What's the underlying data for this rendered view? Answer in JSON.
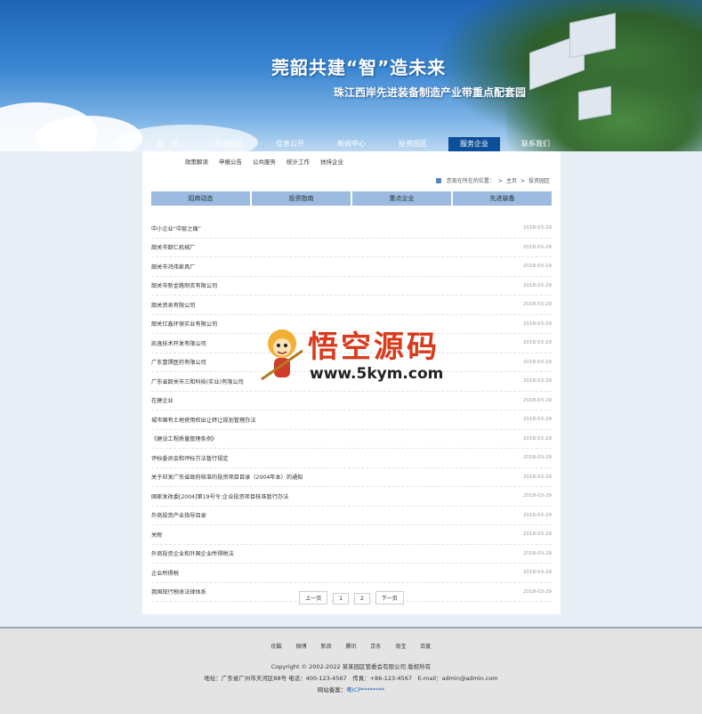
{
  "header": {
    "slogan": "莞韶共建“智”造未来",
    "subslogan": "珠江西岸先进装备制造产业带重点配套园",
    "nav": [
      {
        "label": "首　页"
      },
      {
        "label": "走进园区"
      },
      {
        "label": "信息公开"
      },
      {
        "label": "新闻中心"
      },
      {
        "label": "投资园区"
      },
      {
        "label": "服务企业",
        "active": true
      },
      {
        "label": "联系我们"
      }
    ]
  },
  "subnav": [
    "政策解读",
    "申报公告",
    "公共服务",
    "统计工作",
    "扶持企业"
  ],
  "breadcrumb": {
    "prefix": "您现在所在的位置：",
    "sep": ">",
    "home": "主页",
    "current": "投资园区"
  },
  "tabs": [
    "招商动态",
    "投资指南",
    "重点企业",
    "先进装备"
  ],
  "list": [
    {
      "title": "中小企业“中层之痛”",
      "date": "2018-03-29"
    },
    {
      "title": "韶关市韶仁机械厂",
      "date": "2018-03-29"
    },
    {
      "title": "韶关市鸿伟家具厂",
      "date": "2018-03-29"
    },
    {
      "title": "韶关市新金路制衣有限公司",
      "date": "2018-03-29"
    },
    {
      "title": "韶关资舍有限公司",
      "date": "2018-03-29"
    },
    {
      "title": "韶关亿鑫环保实业有限公司",
      "date": "2018-03-29"
    },
    {
      "title": "凯逸技术开发有限公司",
      "date": "2018-03-29"
    },
    {
      "title": "广东壹馔医药有限公司",
      "date": "2018-03-29"
    },
    {
      "title": "广东省韶关市三和科技(实业)有限公司",
      "date": "2018-03-29"
    },
    {
      "title": "在建企业",
      "date": "2018-03-29"
    },
    {
      "title": "城市国有土地使用权出让转让规划管理办法",
      "date": "2018-03-29"
    },
    {
      "title": "《建设工程质量管理条例》",
      "date": "2018-03-29"
    },
    {
      "title": "评标委员会和评标方法暂行规定",
      "date": "2018-03-29"
    },
    {
      "title": "关于印发广东省政府核准的投资项目目录（2004年本）的通知",
      "date": "2018-03-29"
    },
    {
      "title": "国家发改委[2004]第19号令:企业投资项目核准暂行办法",
      "date": "2018-03-29"
    },
    {
      "title": "外商投资产业指导目录",
      "date": "2018-03-29"
    },
    {
      "title": "关税",
      "date": "2018-03-29"
    },
    {
      "title": "外商投资企业和外国企业所得税法",
      "date": "2018-03-29"
    },
    {
      "title": "企业所得税",
      "date": "2018-03-29"
    },
    {
      "title": "我国现行税收法律体系",
      "date": "2018-03-29"
    }
  ],
  "pager": [
    "上一页",
    "1",
    "2",
    "下一页"
  ],
  "footer": {
    "links": [
      "优酷",
      "微博",
      "新浪",
      "腾讯",
      "京东",
      "淘宝",
      "百度"
    ],
    "copyright": "Copyright © 2002-2022 某某园区管委会有限公司 版权所有",
    "contact": "地址：广东省广州市天河区88号 电话：400-123-4567　传真：+86-123-4567　E-mail：admin@admin.com",
    "icp_label": "网站备案：",
    "icp_value": "粤ICP********"
  },
  "watermark": {
    "title": "悟空源码",
    "url": "www.5kym.com"
  }
}
